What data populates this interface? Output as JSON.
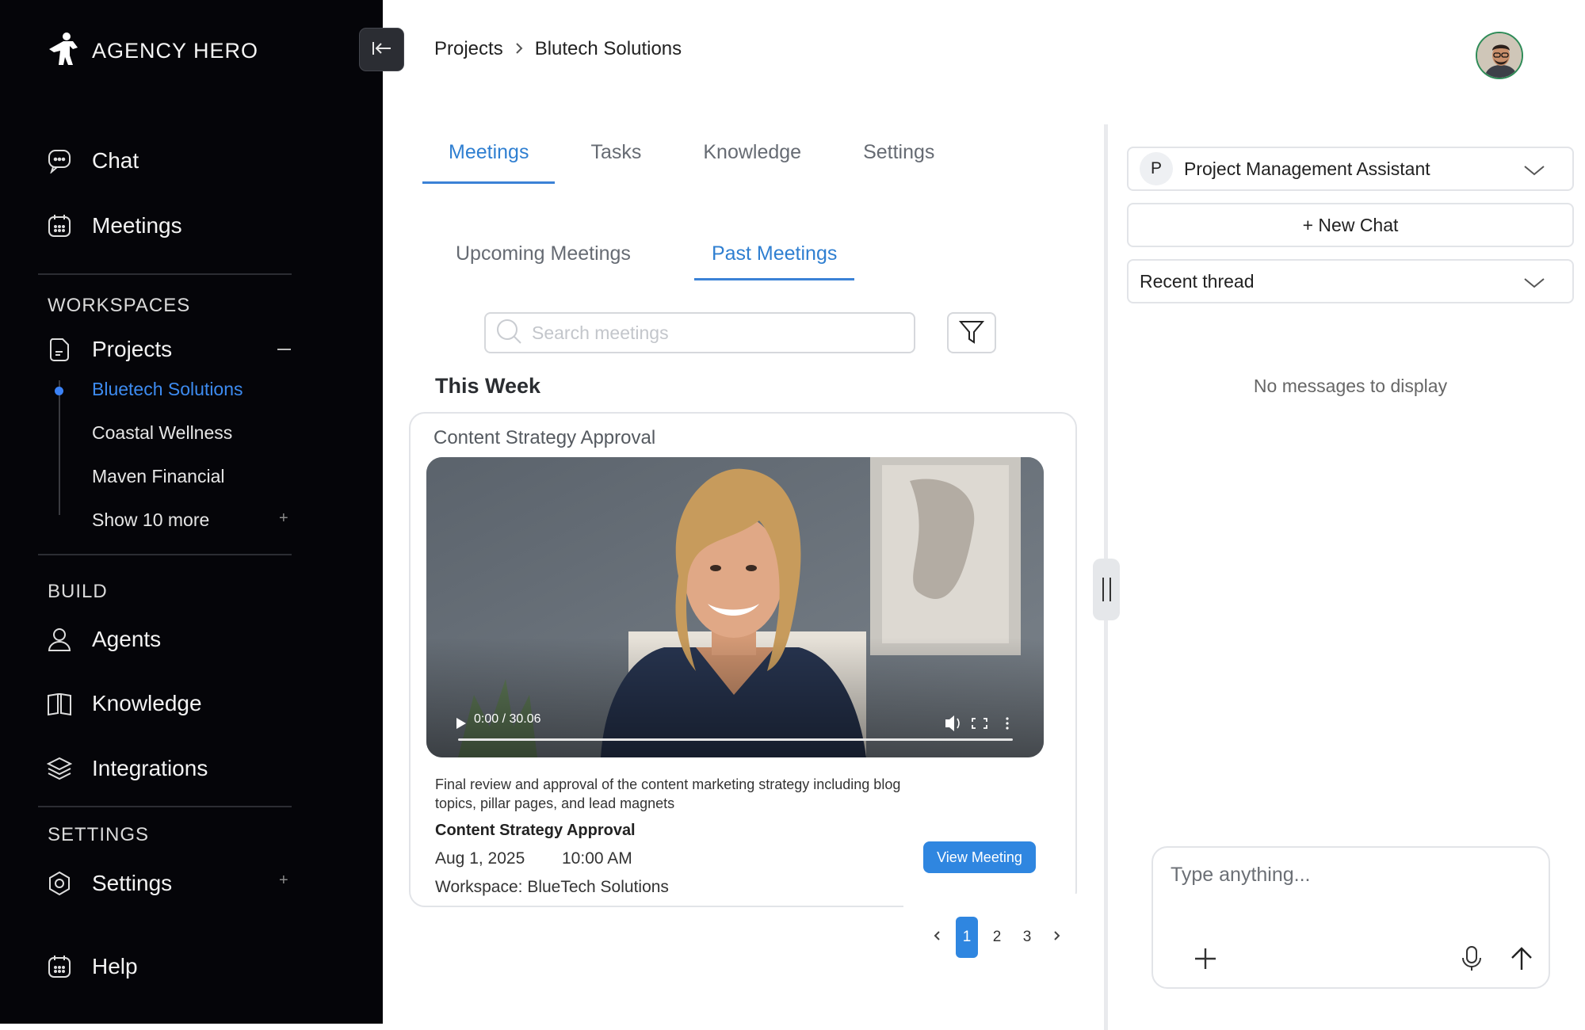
{
  "brand": {
    "name": "AGENCY HERO"
  },
  "sidebar": {
    "nav_top": [
      {
        "label": "Chat",
        "icon": "chat-icon"
      },
      {
        "label": "Meetings",
        "icon": "calendar-icon"
      }
    ],
    "workspaces_label": "WORKSPACES",
    "projects_label": "Projects",
    "projects": [
      {
        "label": "Bluetech Solutions",
        "active": true
      },
      {
        "label": "Coastal Wellness"
      },
      {
        "label": "Maven Financial"
      }
    ],
    "show_more": "Show 10 more",
    "build_label": "BUILD",
    "build_items": [
      {
        "label": "Agents",
        "icon": "person-icon"
      },
      {
        "label": "Knowledge",
        "icon": "book-icon"
      },
      {
        "label": "Integrations",
        "icon": "layers-icon"
      }
    ],
    "settings_label": "SETTINGS",
    "settings_item": "Settings",
    "help_item": "Help"
  },
  "breadcrumb": {
    "root": "Projects",
    "current": "Blutech Solutions"
  },
  "tabs": [
    {
      "label": "Meetings",
      "active": true
    },
    {
      "label": "Tasks"
    },
    {
      "label": "Knowledge"
    },
    {
      "label": "Settings"
    }
  ],
  "subtabs": [
    {
      "label": "Upcoming Meetings"
    },
    {
      "label": "Past Meetings",
      "active": true
    }
  ],
  "search": {
    "placeholder": "Search meetings"
  },
  "section": {
    "title": "This Week"
  },
  "meeting": {
    "card_title": "Content Strategy Approval",
    "video_time": "0:00 / 30.06",
    "progress": 0,
    "description": "Final review and approval of the content marketing strategy including blog topics, pillar pages, and lead magnets",
    "title": "Content Strategy Approval",
    "date": "Aug 1, 2025",
    "time": "10:00 AM",
    "workspace": "Workspace: BlueTech Solutions",
    "view_label": "View Meeting"
  },
  "pagination": {
    "pages": [
      "1",
      "2",
      "3"
    ],
    "current": "1"
  },
  "right_panel": {
    "assistant_initial": "P",
    "assistant_name": "Project Management Assistant",
    "new_chat": "+ New Chat",
    "thread_select": "Recent thread",
    "empty_text": "No messages to display",
    "composer_placeholder": "Type anything..."
  },
  "colors": {
    "accent": "#2f86e0",
    "sidebar_bg": "#050509",
    "active_project": "#3d8bf0"
  }
}
